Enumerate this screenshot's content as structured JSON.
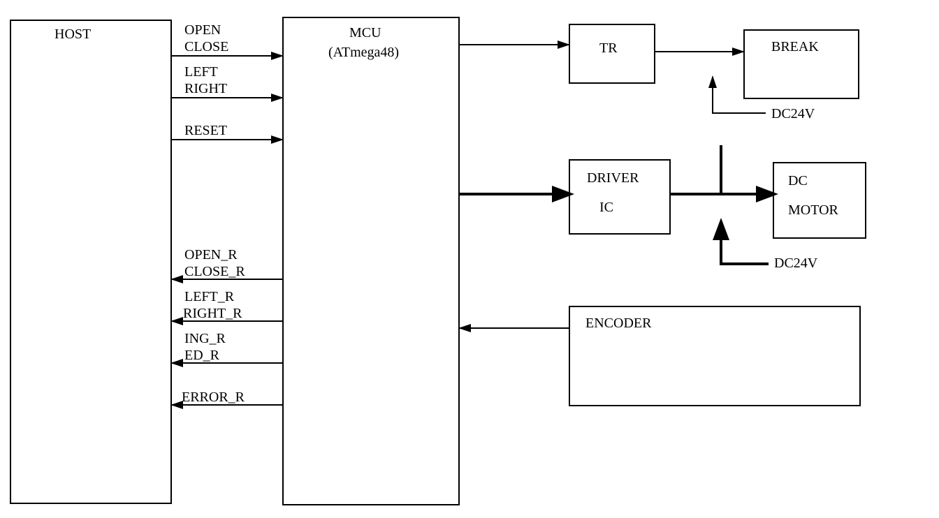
{
  "nodes": {
    "host": "HOST",
    "mcu_line1": "MCU",
    "mcu_line2": "(ATmega48)",
    "tr": "TR",
    "break": "BREAK",
    "driver_line1": "DRIVER",
    "driver_line2": "IC",
    "dcmotor_line1": "DC",
    "dcmotor_line2": "MOTOR",
    "encoder": "ENCODER"
  },
  "signals": {
    "open": "OPEN",
    "close": "CLOSE",
    "left": "LEFT",
    "right": "RIGHT",
    "reset": "RESET",
    "open_r": "OPEN_R",
    "close_r": "CLOSE_R",
    "left_r": "LEFT_R",
    "right_r": "RIGHT_R",
    "ing_r": "ING_R",
    "ed_r": "ED_R",
    "error_r": "ERROR_R"
  },
  "power": {
    "dc24v_a": "DC24V",
    "dc24v_b": "DC24V"
  }
}
